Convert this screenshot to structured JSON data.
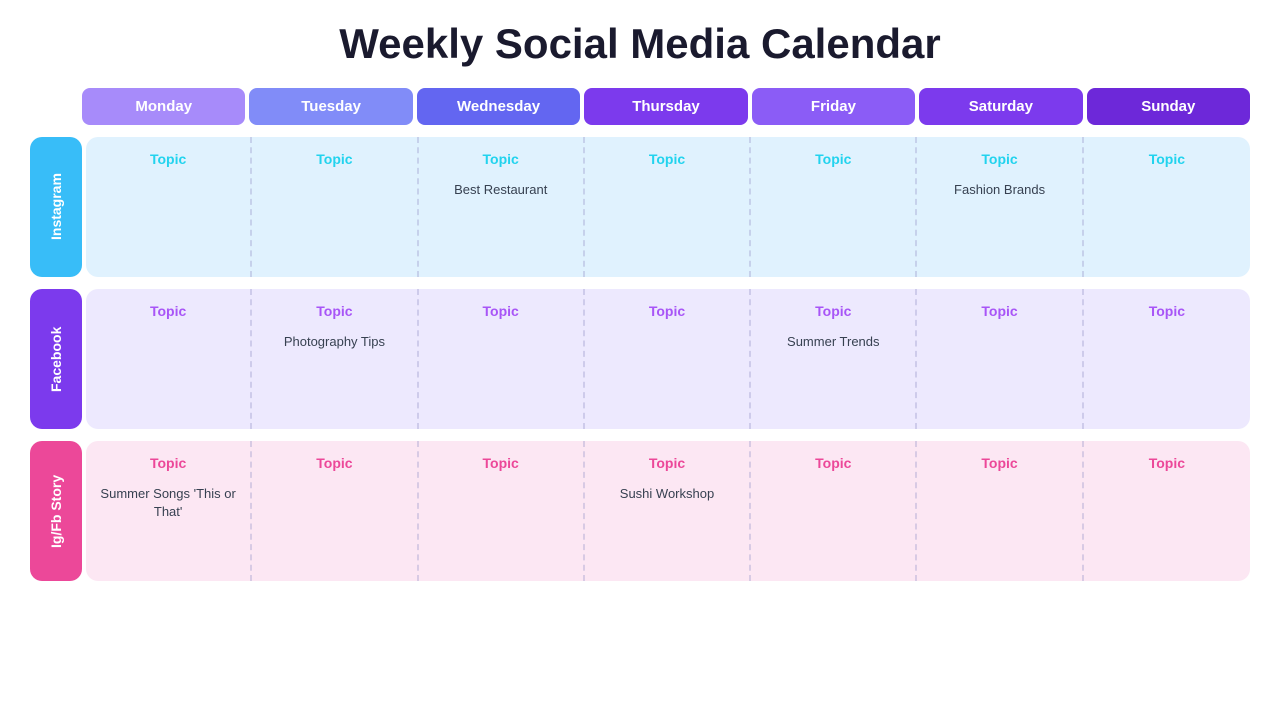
{
  "title": "Weekly Social Media Calendar",
  "days": [
    "Monday",
    "Tuesday",
    "Wednesday",
    "Thursday",
    "Friday",
    "Saturday",
    "Sunday"
  ],
  "rows": [
    {
      "label": "Instagram",
      "labelClass": "label-instagram",
      "rowClass": "row-instagram",
      "topicClass": "topic-cyan",
      "cells": [
        {
          "topic": "Topic",
          "content": ""
        },
        {
          "topic": "Topic",
          "content": ""
        },
        {
          "topic": "Topic",
          "content": "Best Restaurant"
        },
        {
          "topic": "Topic",
          "content": ""
        },
        {
          "topic": "Topic",
          "content": ""
        },
        {
          "topic": "Topic",
          "content": "Fashion Brands"
        },
        {
          "topic": "Topic",
          "content": ""
        }
      ]
    },
    {
      "label": "Facebook",
      "labelClass": "label-facebook",
      "rowClass": "row-facebook",
      "topicClass": "topic-purple",
      "cells": [
        {
          "topic": "Topic",
          "content": ""
        },
        {
          "topic": "Topic",
          "content": "Photography Tips"
        },
        {
          "topic": "Topic",
          "content": ""
        },
        {
          "topic": "Topic",
          "content": ""
        },
        {
          "topic": "Topic",
          "content": "Summer Trends"
        },
        {
          "topic": "Topic",
          "content": ""
        },
        {
          "topic": "Topic",
          "content": ""
        }
      ]
    },
    {
      "label": "Ig/Fb Story",
      "labelClass": "label-igfbstory",
      "rowClass": "row-igfbstory",
      "topicClass": "topic-pink",
      "cells": [
        {
          "topic": "Topic",
          "content": "Summer Songs\n'This or That'"
        },
        {
          "topic": "Topic",
          "content": ""
        },
        {
          "topic": "Topic",
          "content": ""
        },
        {
          "topic": "Topic",
          "content": "Sushi Workshop"
        },
        {
          "topic": "Topic",
          "content": ""
        },
        {
          "topic": "Topic",
          "content": ""
        },
        {
          "topic": "Topic",
          "content": ""
        }
      ]
    }
  ],
  "header_colors": [
    "header-monday",
    "header-tuesday",
    "header-wednesday",
    "header-thursday",
    "header-friday",
    "header-saturday",
    "header-sunday"
  ]
}
